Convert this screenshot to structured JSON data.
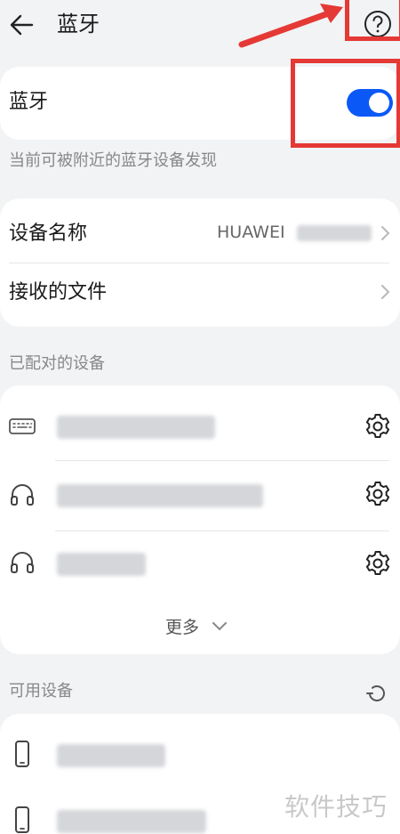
{
  "header": {
    "title": "蓝牙"
  },
  "bluetooth": {
    "label": "蓝牙",
    "enabled": true,
    "hint": "当前可被附近的蓝牙设备发现"
  },
  "settings": {
    "device_name_label": "设备名称",
    "device_name_value": "HUAWEI",
    "received_files_label": "接收的文件"
  },
  "paired": {
    "section_label": "已配对的设备",
    "more_label": "更多"
  },
  "available": {
    "section_label": "可用设备"
  },
  "watermark": "软件技巧",
  "colors": {
    "accent": "#0a59f7",
    "annotation": "#e53935"
  }
}
